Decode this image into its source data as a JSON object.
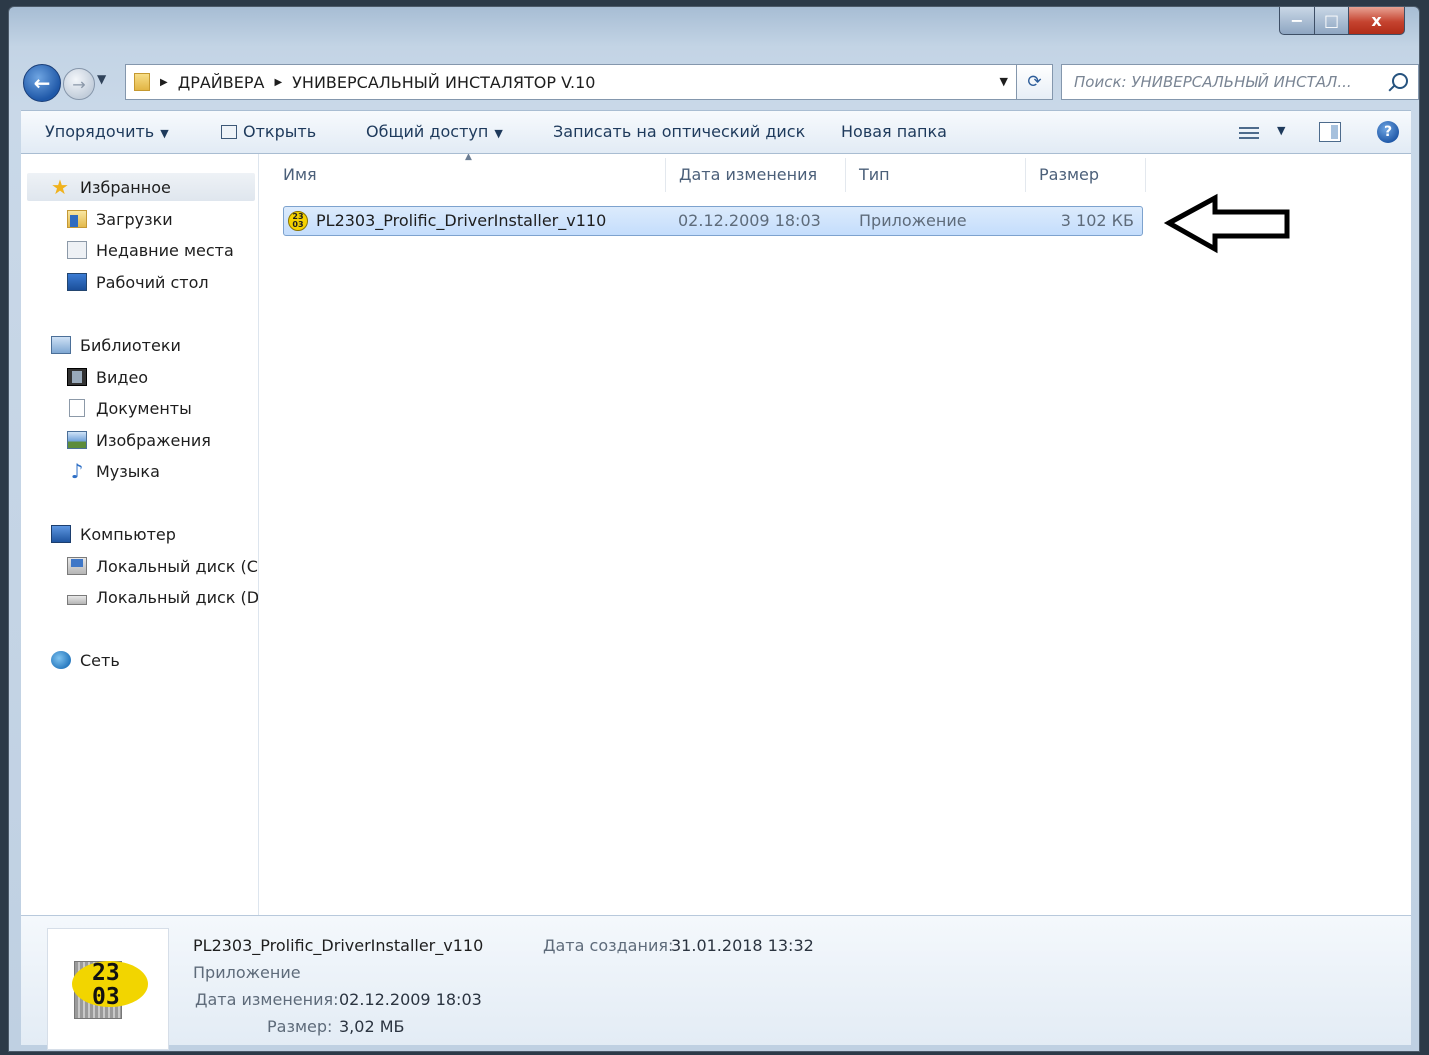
{
  "window": {
    "caption_buttons": {
      "minimize": "−",
      "maximize": "□",
      "close": "x"
    }
  },
  "navbar": {
    "back_glyph": "←",
    "forward_glyph": "→",
    "breadcrumb": [
      "ДРАЙВЕРА",
      "УНИВЕРСАЛЬНЫЙ ИНСТАЛЯТОР V.10"
    ],
    "search_placeholder": "Поиск: УНИВЕРСАЛЬНЫЙ ИНСТАЛ...",
    "refresh_glyph": "⟳"
  },
  "toolbar": {
    "organize": "Упорядочить",
    "open": "Открыть",
    "share": "Общий доступ",
    "burn": "Записать на оптический диск",
    "new_folder": "Новая папка",
    "help_glyph": "?"
  },
  "sidebar": {
    "favorites": {
      "label": "Избранное",
      "items": [
        "Загрузки",
        "Недавние места",
        "Рабочий стол"
      ]
    },
    "libraries": {
      "label": "Библиотеки",
      "items": [
        "Видео",
        "Документы",
        "Изображения",
        "Музыка"
      ]
    },
    "computer": {
      "label": "Компьютер",
      "items": [
        "Локальный диск (C",
        "Локальный диск (D"
      ]
    },
    "network": {
      "label": "Сеть"
    }
  },
  "columns": {
    "name": "Имя",
    "date": "Дата изменения",
    "type": "Тип",
    "size": "Размер"
  },
  "files": [
    {
      "name": "PL2303_Prolific_DriverInstaller_v110",
      "date": "02.12.2009 18:03",
      "type": "Приложение",
      "size": "3 102 КБ",
      "icon_text": "23 03"
    }
  ],
  "details": {
    "name": "PL2303_Prolific_DriverInstaller_v110",
    "type": "Приложение",
    "modified_label": "Дата изменения:",
    "modified_value": "02.12.2009 18:03",
    "size_label": "Размер:",
    "size_value": "3,02 МБ",
    "created_label": "Дата создания:",
    "created_value": "31.01.2018 13:32",
    "thumb_line1": "23",
    "thumb_line2": "03"
  },
  "colors": {
    "selection": "#cce4ff",
    "accent": "#1f58a8",
    "icon_yellow": "#f2d500"
  }
}
